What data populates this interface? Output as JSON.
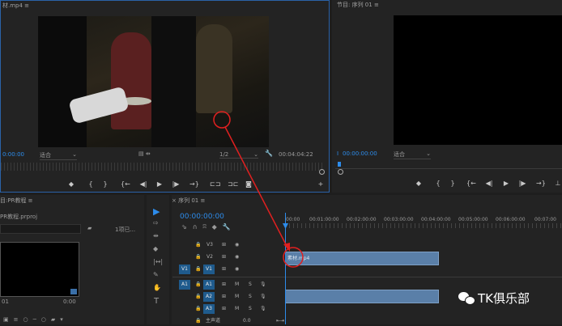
{
  "source_monitor": {
    "tab_title": "材.mp4 ≡",
    "timecode": "0:00:00",
    "fit": "适合",
    "resolution": "1/2",
    "duration": "00:04:04:22"
  },
  "program_monitor": {
    "tab_title": "节目: 序列 01 ≡",
    "timecode": "00:00:00:00",
    "fit": "适合"
  },
  "project_panel": {
    "tab_title": "目:PR教程 ≡",
    "file_name": "PR教程.prproj",
    "item_count": "1项已...",
    "clip_name": "01",
    "clip_duration": "0:00"
  },
  "timeline": {
    "tab_title": "序列 01 ≡",
    "timecode": "00:00:00:00",
    "ruler": [
      "00:00",
      "00:01:00:00",
      "00:02:00:00",
      "00:03:00:00",
      "00:04:00:00",
      "00:05:00:00",
      "00:06:00:00",
      "00:07:00"
    ],
    "tracks": {
      "v3": "V3",
      "v2": "V2",
      "v1": "V1",
      "src_v1": "V1",
      "a1": "A1",
      "src_a1": "A1",
      "a2": "A2",
      "a3": "A3",
      "master": "主声道",
      "master_value": "0.0"
    },
    "video_clip_label": "素材.mp4",
    "mute": "M",
    "solo": "S"
  },
  "watermark": "TK俱乐部",
  "colors": {
    "accent": "#2d8ceb",
    "clip_video": "#5a7fa8",
    "clip_audio": "#5a7fa8",
    "highlight": "#e02020"
  }
}
